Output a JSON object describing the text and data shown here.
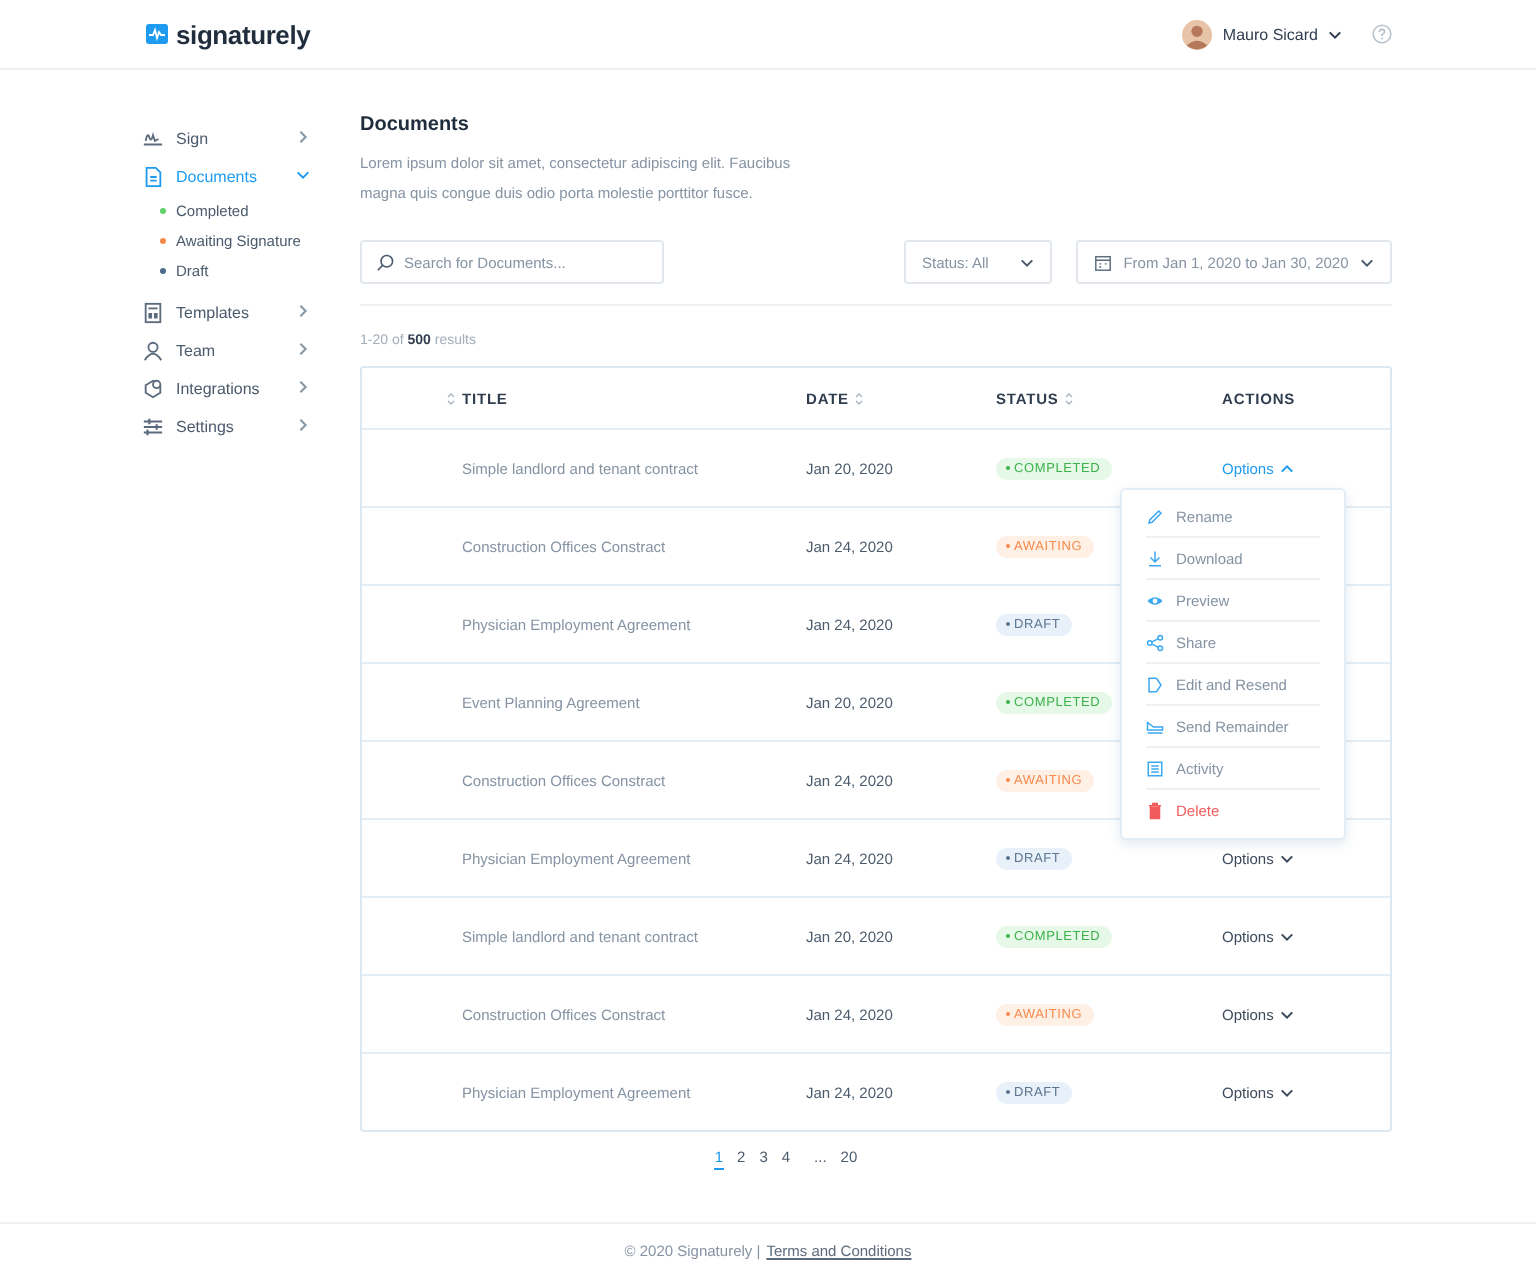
{
  "header": {
    "brand": "signaturely",
    "user": "Mauro Sicard"
  },
  "sidebar": {
    "items": [
      {
        "label": "Sign",
        "selected": false,
        "expanded": false
      },
      {
        "label": "Documents",
        "selected": true,
        "expanded": true,
        "children": [
          {
            "label": "Completed",
            "color": "#5fd068"
          },
          {
            "label": "Awaiting Signature",
            "color": "#f58a4b"
          },
          {
            "label": "Draft",
            "color": "#4a6a88"
          }
        ]
      },
      {
        "label": "Templates",
        "selected": false,
        "expanded": false
      },
      {
        "label": "Team",
        "selected": false,
        "expanded": false
      },
      {
        "label": "Integrations",
        "selected": false,
        "expanded": false
      },
      {
        "label": "Settings",
        "selected": false,
        "expanded": false
      }
    ]
  },
  "page": {
    "title": "Documents",
    "description": "Lorem ipsum dolor sit amet, consectetur adipiscing elit. Faucibus magna quis congue duis odio porta molestie porttitor fusce."
  },
  "filters": {
    "search": {
      "placeholder": "Search for Documents..."
    },
    "status": "Status: All",
    "date_range": "From Jan 1, 2020 to Jan  30, 2020"
  },
  "results": "1-20 of **500** results",
  "table": {
    "columns": [
      {
        "label": "TITLE",
        "sortable": true
      },
      {
        "label": "DATE",
        "sortable": true
      },
      {
        "label": "STATUS",
        "sortable": true
      },
      {
        "label": "ACTIONS",
        "sortable": false
      }
    ],
    "rows": [
      {
        "title": "Simple landlord and tenant contract",
        "date": "Jan 20, 2020",
        "status": {
          "kind": "completed",
          "label": "COMPLETED"
        },
        "options": {
          "label": "Options",
          "open": true
        }
      },
      {
        "title": "Construction Offices Constract",
        "date": "Jan 24, 2020",
        "status": {
          "kind": "awaiting",
          "label": "AWAITING"
        }
      },
      {
        "title": "Physician Employment Agreement",
        "date": "Jan 24, 2020",
        "status": {
          "kind": "draft",
          "label": "DRAFT"
        }
      },
      {
        "title": "Event Planning Agreement",
        "date": "Jan 20, 2020",
        "status": {
          "kind": "completed",
          "label": "COMPLETED"
        }
      },
      {
        "title": "Construction Offices Constract",
        "date": "Jan 24, 2020",
        "status": {
          "kind": "awaiting",
          "label": "AWAITING"
        }
      },
      {
        "title": "Physician Employment Agreement",
        "date": "Jan 24, 2020",
        "status": {
          "kind": "draft",
          "label": "DRAFT"
        },
        "options": {
          "label": "Options",
          "open": false
        }
      },
      {
        "title": "Simple landlord and tenant contract",
        "date": "Jan 20, 2020",
        "status": {
          "kind": "completed",
          "label": "COMPLETED"
        },
        "options": {
          "label": "Options",
          "open": false
        }
      },
      {
        "title": "Construction Offices Constract",
        "date": "Jan 24, 2020",
        "status": {
          "kind": "awaiting",
          "label": "AWAITING"
        },
        "options": {
          "label": "Options",
          "open": false
        }
      },
      {
        "title": "Physician Employment Agreement",
        "date": "Jan 24, 2020",
        "status": {
          "kind": "draft",
          "label": "DRAFT"
        },
        "options": {
          "label": "Options",
          "open": false
        }
      }
    ]
  },
  "options_menu": {
    "items": [
      {
        "label": "Rename",
        "kind": "normal"
      },
      {
        "label": "Download",
        "kind": "normal"
      },
      {
        "label": "Preview",
        "kind": "normal"
      },
      {
        "label": "Share",
        "kind": "normal"
      },
      {
        "label": "Edit and Resend",
        "kind": "normal"
      },
      {
        "label": "Send Remainder",
        "kind": "normal"
      },
      {
        "label": "Activity",
        "kind": "normal"
      },
      {
        "label": "Delete",
        "kind": "danger"
      }
    ]
  },
  "pagination": [
    {
      "label": "1",
      "selected": true
    },
    {
      "label": "2",
      "selected": false
    },
    {
      "label": "3",
      "selected": false
    },
    {
      "label": "4",
      "selected": false
    },
    {
      "label": "...",
      "selected": false
    },
    {
      "label": "20",
      "selected": false
    }
  ],
  "footer": {
    "copyright": "© 2020 Signaturely |",
    "link": "Terms and Conditions"
  }
}
